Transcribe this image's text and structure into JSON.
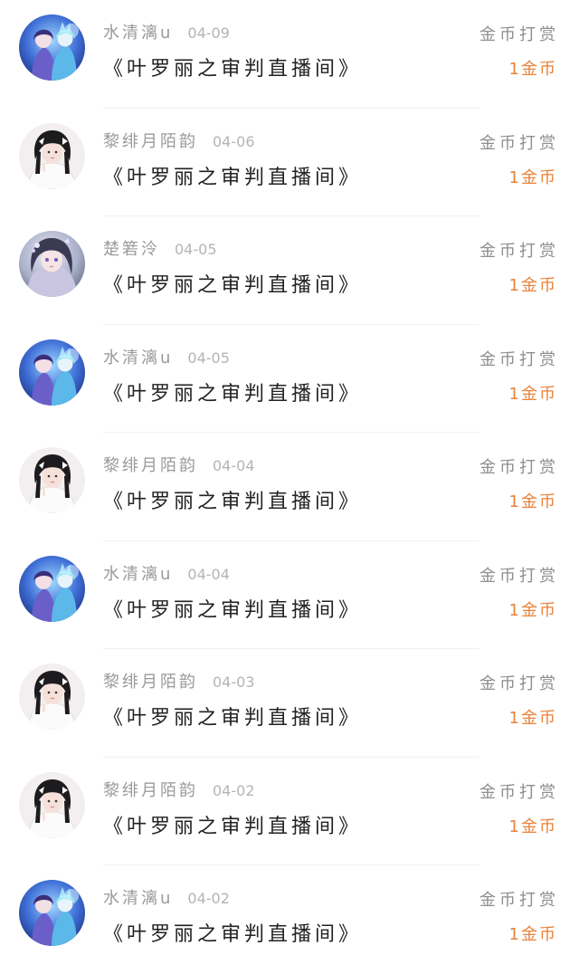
{
  "action_label": "金币打赏",
  "rows": [
    {
      "user": "水清漓u",
      "date": "04-09",
      "title": "《叶罗丽之审判直播间》",
      "amount": "1金币",
      "avatar": "anime-blue"
    },
    {
      "user": "黎绯月陌韵",
      "date": "04-06",
      "title": "《叶罗丽之审判直播间》",
      "amount": "1金币",
      "avatar": "girl-white"
    },
    {
      "user": "楚箬泠",
      "date": "04-05",
      "title": "《叶罗丽之审判直播间》",
      "amount": "1金币",
      "avatar": "anime-grey"
    },
    {
      "user": "水清漓u",
      "date": "04-05",
      "title": "《叶罗丽之审判直播间》",
      "amount": "1金币",
      "avatar": "anime-blue"
    },
    {
      "user": "黎绯月陌韵",
      "date": "04-04",
      "title": "《叶罗丽之审判直播间》",
      "amount": "1金币",
      "avatar": "girl-white"
    },
    {
      "user": "水清漓u",
      "date": "04-04",
      "title": "《叶罗丽之审判直播间》",
      "amount": "1金币",
      "avatar": "anime-blue"
    },
    {
      "user": "黎绯月陌韵",
      "date": "04-03",
      "title": "《叶罗丽之审判直播间》",
      "amount": "1金币",
      "avatar": "girl-white"
    },
    {
      "user": "黎绯月陌韵",
      "date": "04-02",
      "title": "《叶罗丽之审判直播间》",
      "amount": "1金币",
      "avatar": "girl-white"
    },
    {
      "user": "水清漓u",
      "date": "04-02",
      "title": "《叶罗丽之审判直播间》",
      "amount": "1金币",
      "avatar": "anime-blue"
    }
  ]
}
